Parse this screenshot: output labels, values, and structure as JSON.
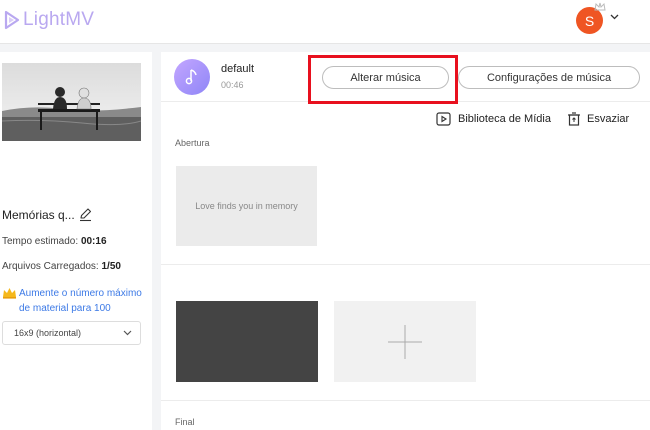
{
  "header": {
    "logo_text": "LightMV",
    "avatar_initial": "S",
    "avatar_color": "#ef5523"
  },
  "sidebar": {
    "project_title": "Memórias q...",
    "estimated_time_label": "Tempo estimado:",
    "estimated_time_value": "00:16",
    "uploaded_files_label": "Arquivos Carregados:",
    "uploaded_files_value": "1/50",
    "upgrade_text": "Aumente o número máximo de material para 100",
    "aspect_ratio": "16x9 (horizontal)"
  },
  "music": {
    "track_name": "default",
    "duration": "00:46",
    "change_music_label": "Alterar música",
    "music_settings_label": "Configurações de música",
    "highlight_color": "#e8101e"
  },
  "toolbar": {
    "media_library_label": "Biblioteca de Mídia",
    "clear_label": "Esvaziar"
  },
  "timeline": {
    "opening_label": "Abertura",
    "opening_text": "Love finds you in memory",
    "final_label": "Final"
  },
  "icons": {
    "logo": "lightmv-logo-icon",
    "music": "music-note-icon",
    "edit": "edit-icon",
    "crown": "crown-icon",
    "media_library": "media-library-icon",
    "clear": "trash-icon",
    "add": "plus-icon",
    "dropdown": "chevron-down-icon"
  }
}
